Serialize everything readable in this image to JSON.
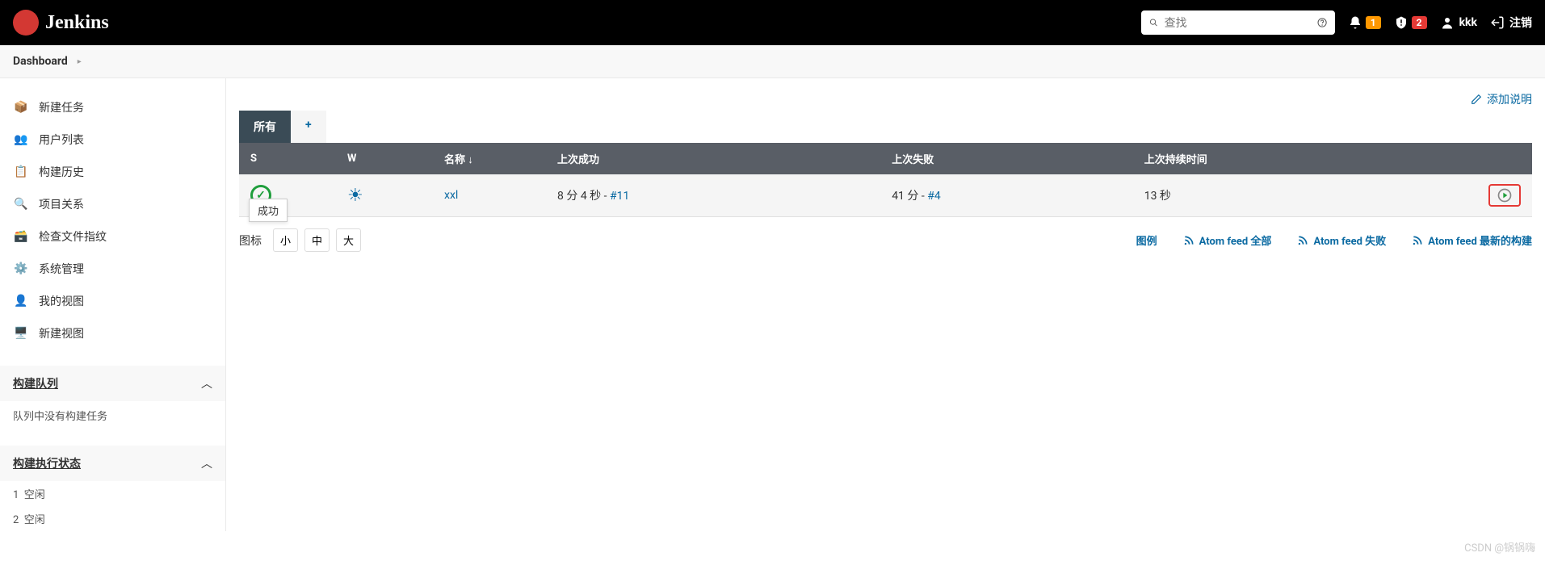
{
  "header": {
    "brand": "Jenkins",
    "search_placeholder": "查找",
    "notif_count": "1",
    "alert_count": "2",
    "username": "kkk",
    "logout": "注销"
  },
  "breadcrumb": {
    "dashboard": "Dashboard"
  },
  "sidebar": {
    "items": [
      {
        "label": "新建任务"
      },
      {
        "label": "用户列表"
      },
      {
        "label": "构建历史"
      },
      {
        "label": "项目关系"
      },
      {
        "label": "检查文件指纹"
      },
      {
        "label": "系统管理"
      },
      {
        "label": "我的视图"
      },
      {
        "label": "新建视图"
      }
    ],
    "build_queue": {
      "title": "构建队列",
      "empty": "队列中没有构建任务"
    },
    "executors": {
      "title": "构建执行状态",
      "items": [
        {
          "num": "1",
          "label": "空闲"
        },
        {
          "num": "2",
          "label": "空闲"
        }
      ]
    }
  },
  "content": {
    "add_description": "添加说明",
    "tabs": {
      "all": "所有",
      "plus": "+"
    },
    "table": {
      "headers": {
        "status": "S",
        "weather": "W",
        "name": "名称 ↓",
        "last_success": "上次成功",
        "last_failure": "上次失败",
        "last_duration": "上次持续时间"
      },
      "rows": [
        {
          "name": "xxl",
          "last_success_text": "8 分 4 秒 - ",
          "last_success_build": "#11",
          "last_failure_text": "41 分 - ",
          "last_failure_build": "#4",
          "duration": "13 秒"
        }
      ]
    },
    "tooltip": "成功",
    "footer": {
      "icon_label": "图标",
      "sizes": {
        "small": "小",
        "medium": "中",
        "large": "大"
      },
      "legend": "图例",
      "feed_all": "Atom feed 全部",
      "feed_fail": "Atom feed 失败",
      "feed_latest": "Atom feed 最新的构建"
    }
  },
  "watermark": "CSDN @锅锅嗨"
}
